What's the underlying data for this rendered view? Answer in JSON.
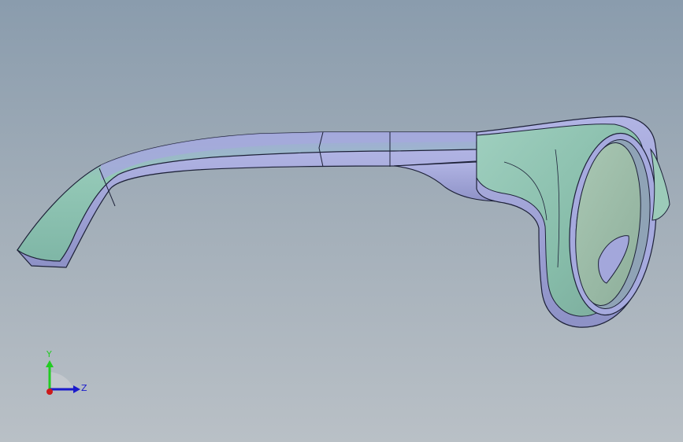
{
  "viewport": {
    "colors": {
      "background_top": "#8a9cad",
      "background_bottom": "#b9c0c6",
      "frame_face": "#8fc4b4",
      "frame_side": "#9ea3d6",
      "edge": "#1d2138",
      "lens": "#9fbba8"
    }
  },
  "triad": {
    "y_label": "Y",
    "z_label": "Z",
    "colors": {
      "y_axis": "#22cc22",
      "z_axis": "#1a1acc",
      "origin": "#cc1a1a"
    }
  }
}
